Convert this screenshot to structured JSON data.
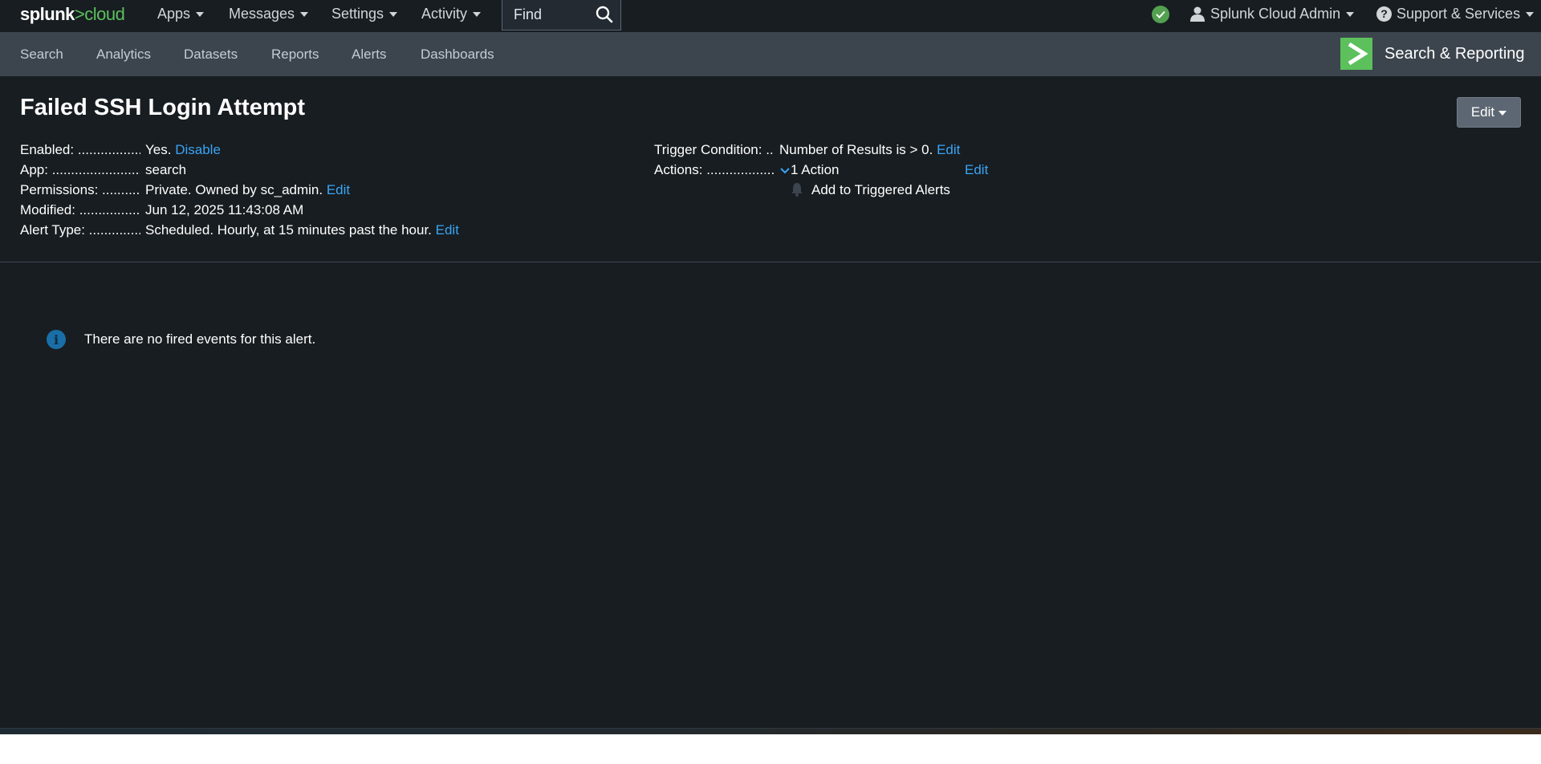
{
  "topbar": {
    "logo_main": "splunk",
    "logo_gt": ">",
    "logo_cloud": "cloud",
    "menus": [
      "Apps",
      "Messages",
      "Settings",
      "Activity"
    ],
    "find_placeholder": "Find",
    "user": "Splunk Cloud Admin",
    "support": "Support & Services"
  },
  "appbar": {
    "nav": [
      "Search",
      "Analytics",
      "Datasets",
      "Reports",
      "Alerts",
      "Dashboards"
    ],
    "app_name": "Search & Reporting"
  },
  "alert": {
    "title": "Failed SSH Login Attempt",
    "edit_button": "Edit",
    "enabled_label": "Enabled: ........................................",
    "enabled_value": "Yes.",
    "enabled_link": "Disable",
    "app_label": "App: ..............................................",
    "app_value": "search",
    "permissions_label": "Permissions: ..............................",
    "permissions_value": "Private. Owned by sc_admin.",
    "permissions_link": "Edit",
    "modified_label": "Modified: .....................................",
    "modified_value": "Jun 12, 2025 11:43:08 AM",
    "alert_type_label": "Alert Type: ..................................",
    "alert_type_value": "Scheduled. Hourly, at 15 minutes past the hour.",
    "alert_type_link": "Edit",
    "trigger_label": "Trigger Condition: ..",
    "trigger_value": "Number of Results is > 0.",
    "trigger_link": "Edit",
    "actions_label": "Actions: .........................................",
    "actions_value": "1 Action",
    "actions_link": "Edit",
    "action_item": "Add to Triggered Alerts"
  },
  "message": {
    "text": "There are no fired events for this alert."
  },
  "colors": {
    "background": "#171d21",
    "appbar": "#3c444d",
    "link": "#3ba4f5",
    "brand_green": "#5cc05c"
  }
}
